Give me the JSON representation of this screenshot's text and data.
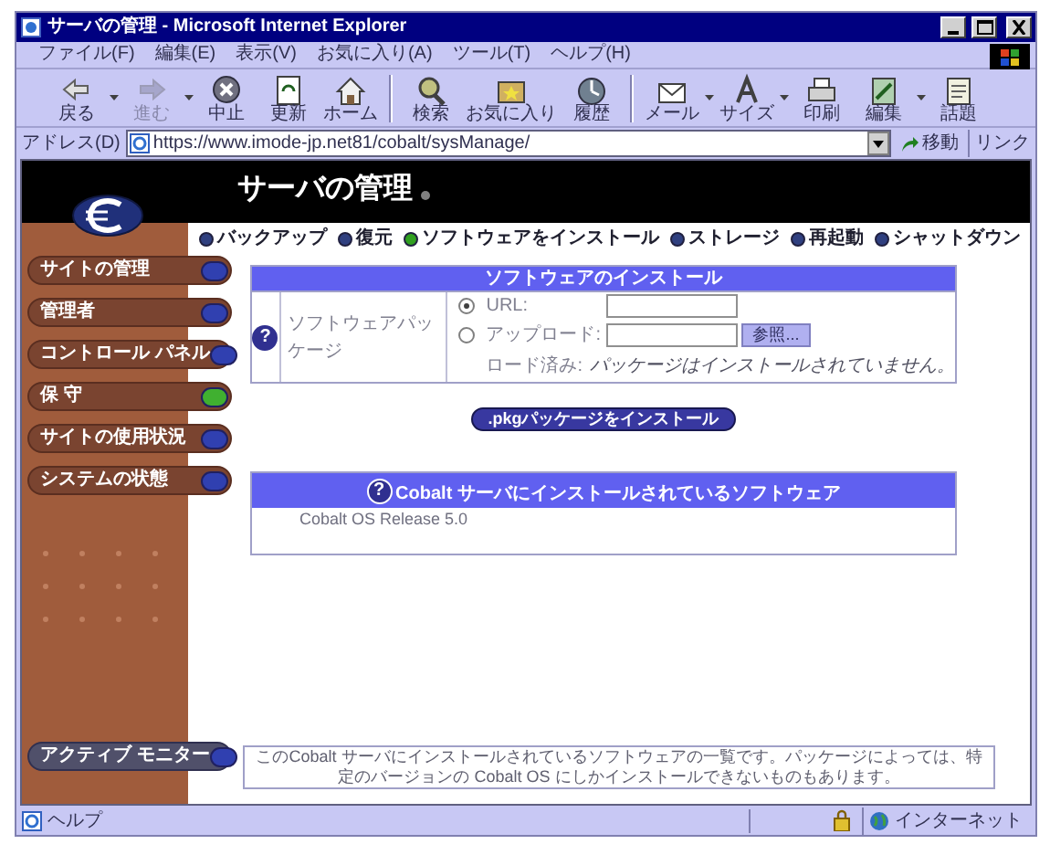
{
  "window": {
    "title": "サーバの管理 - Microsoft Internet Explorer"
  },
  "menu": [
    "ファイル(F)",
    "編集(E)",
    "表示(V)",
    "お気に入り(A)",
    "ツール(T)",
    "ヘルプ(H)"
  ],
  "toolbar": [
    {
      "label": "戻る",
      "dropdown": true,
      "disabled": false
    },
    {
      "label": "進む",
      "dropdown": true,
      "disabled": true
    },
    {
      "label": "中止",
      "dropdown": false,
      "disabled": false
    },
    {
      "label": "更新",
      "dropdown": false,
      "disabled": false
    },
    {
      "label": "ホーム",
      "dropdown": false,
      "disabled": false
    },
    {
      "label": "検索",
      "dropdown": false,
      "disabled": false
    },
    {
      "label": "お気に入り",
      "dropdown": false,
      "disabled": false
    },
    {
      "label": "履歴",
      "dropdown": false,
      "disabled": false
    },
    {
      "label": "メール",
      "dropdown": true,
      "disabled": false
    },
    {
      "label": "サイズ",
      "dropdown": true,
      "disabled": false
    },
    {
      "label": "印刷",
      "dropdown": false,
      "disabled": false
    },
    {
      "label": "編集",
      "dropdown": true,
      "disabled": false
    },
    {
      "label": "話題",
      "dropdown": false,
      "disabled": false
    }
  ],
  "address_bar": {
    "label": "アドレス(D)",
    "url": "https://www.imode-jp.net81/cobalt/sysManage/",
    "go": "移動",
    "links": "リンク"
  },
  "page": {
    "title": "サーバの管理",
    "sidebar": [
      {
        "label": "サイトの管理",
        "selected": false
      },
      {
        "label": "管理者",
        "selected": false
      },
      {
        "label": "コントロール パネル",
        "selected": false
      },
      {
        "label": "保 守",
        "selected": true
      },
      {
        "label": "サイトの使用状況",
        "selected": false
      },
      {
        "label": "システムの状態",
        "selected": false
      }
    ],
    "monitor": {
      "label": "アクティブ モニター"
    },
    "tabs": [
      {
        "label": "バックアップ",
        "selected": false
      },
      {
        "label": "復元",
        "selected": false
      },
      {
        "label": "ソフトウェアをインストール",
        "selected": true
      },
      {
        "label": "ストレージ",
        "selected": false
      },
      {
        "label": "再起動",
        "selected": false
      },
      {
        "label": "シャットダウン",
        "selected": false
      }
    ],
    "install": {
      "title": "ソフトウェアのインストール",
      "field_label": "ソフトウェアパッケージ",
      "help_icon": "?",
      "options": [
        {
          "label": "URL:",
          "selected": true
        },
        {
          "label": "アップロード:",
          "selected": false,
          "browse": "参照..."
        }
      ],
      "loaded_label": "ロード済み:",
      "loaded_value": "パッケージはインストールされていません。"
    },
    "install_button": ".pkgパッケージをインストール",
    "installed": {
      "help_icon": "?",
      "title": "Cobalt サーバにインストールされているソフトウェア",
      "rows": [
        "Cobalt OS Release 5.0"
      ]
    },
    "note": "このCobalt サーバにインストールされているソフトウェアの一覧です。パッケージによっては、特定のバージョンの Cobalt OS にしかインストールできないものもあります。"
  },
  "status_bar": {
    "text": "ヘルプ",
    "zone": "インターネット"
  }
}
